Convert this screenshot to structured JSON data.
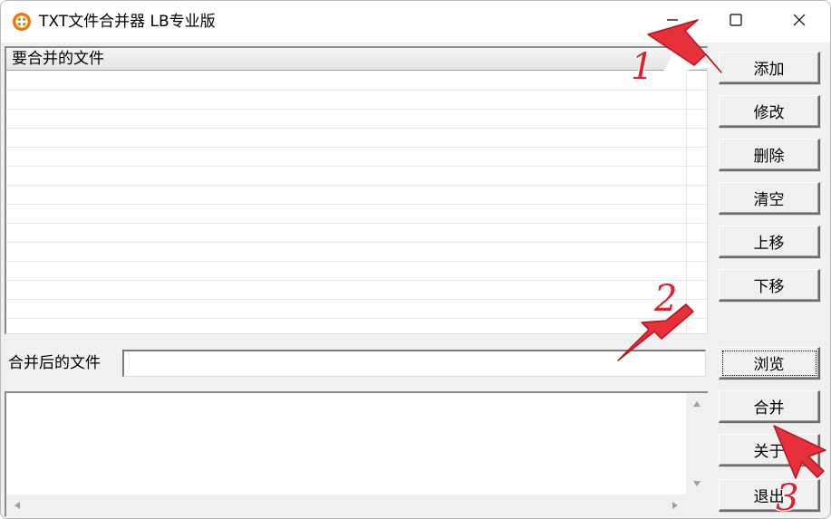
{
  "window": {
    "title": "TXT文件合并器 LB专业版",
    "icon": "app-logo-icon",
    "controls": [
      "minimize-icon",
      "maximize-icon",
      "close-icon"
    ]
  },
  "file_list": {
    "column_header": "要合并的文件",
    "items": []
  },
  "buttons": {
    "add": "添加",
    "edit": "修改",
    "delete": "删除",
    "clear": "清空",
    "move_up": "上移",
    "move_down": "下移",
    "browse": "浏览",
    "merge": "合并",
    "about": "关于",
    "exit": "退出"
  },
  "output": {
    "label": "合并后的文件",
    "value": ""
  },
  "log": {
    "value": ""
  },
  "annotations": {
    "step1": "1",
    "step2": "2",
    "step3": "3",
    "color": "#e0212e"
  }
}
